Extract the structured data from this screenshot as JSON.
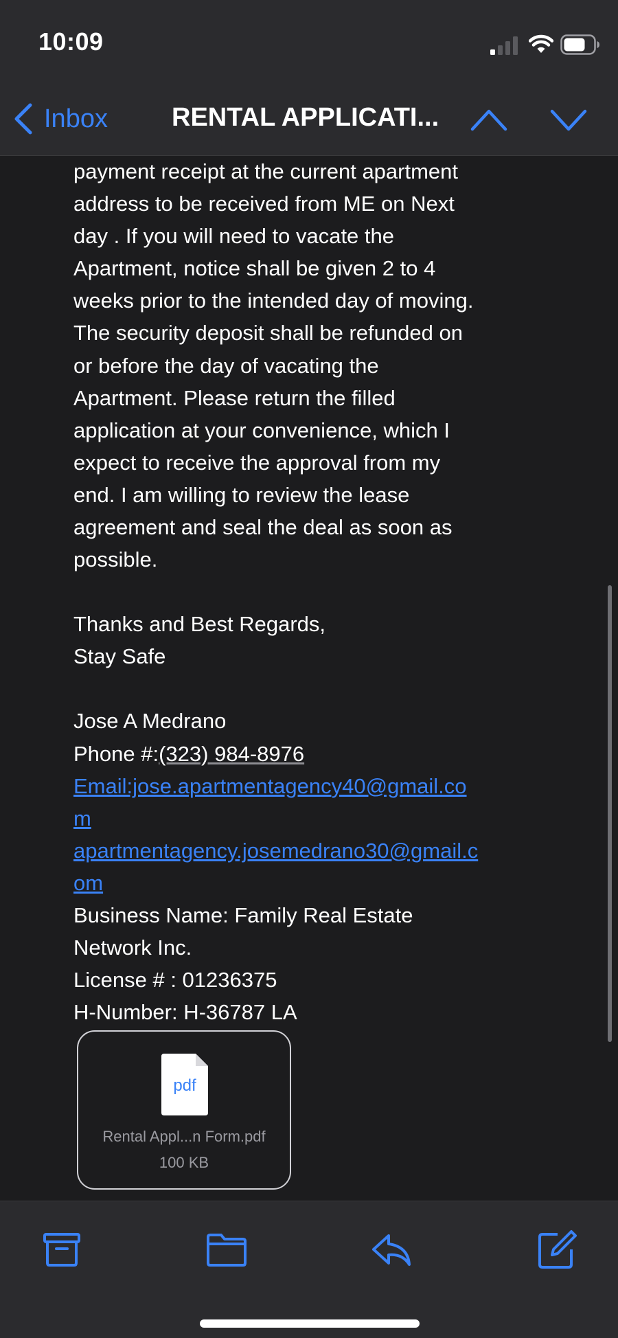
{
  "status_bar": {
    "time": "10:09"
  },
  "nav": {
    "back_label": "Inbox",
    "title": "RENTAL APPLICATI..."
  },
  "message": {
    "body_lines": [
      "payment receipt at the current apartment",
      "address to be received from ME on Next",
      "day . If you will need to vacate the",
      "Apartment, notice shall be given 2 to 4",
      "weeks prior to the intended day of moving.",
      "The security deposit shall be refunded on",
      "or before the day of vacating the",
      "Apartment. Please return the filled",
      "application at your convenience, which I",
      "expect to receive the approval  from my",
      "end. I am willing to review the lease",
      "agreement and seal the deal as soon as",
      "possible."
    ],
    "closing_line_1": "Thanks and Best Regards,",
    "closing_line_2": "Stay Safe",
    "sender_name": "Jose A Medrano",
    "phone_prefix": "Phone #:",
    "phone_number": "(323) 984-8976",
    "email_1_line_1": "Email:jose.apartmentagency40@gmail.co",
    "email_1_line_2": "m",
    "email_2_line_1": "apartmentagency.josemedrano30@gmail.c",
    "email_2_line_2": "om",
    "business_line_1": "Business Name:  Family Real Estate",
    "business_line_2": "Network Inc.",
    "license": "License # : 01236375",
    "h_number": "H-Number: H-36787 LA"
  },
  "attachment": {
    "type_label": "pdf",
    "name": "Rental Appl...n Form.pdf",
    "size": "100 KB"
  },
  "colors": {
    "accent": "#3a82f7",
    "background": "#1c1c1e",
    "bar_background": "#2b2b2e"
  },
  "icons": {
    "signal": "cellular-signal-icon",
    "wifi": "wifi-icon",
    "battery": "battery-icon",
    "back": "chevron-left-icon",
    "up": "chevron-up-icon",
    "down": "chevron-down-icon",
    "archive": "archive-box-icon",
    "folder": "folder-icon",
    "reply": "reply-arrow-icon",
    "compose": "compose-icon",
    "pdf": "pdf-document-icon"
  }
}
